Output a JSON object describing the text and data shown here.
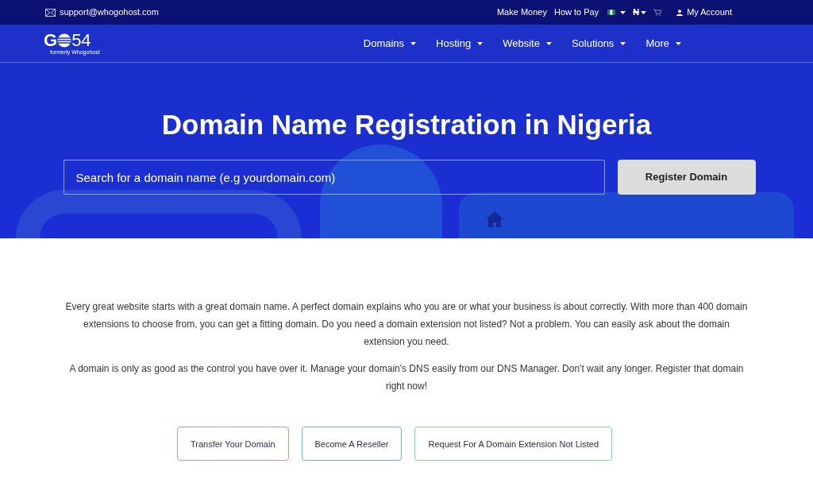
{
  "top_bar": {
    "email": "support@whogohost.com",
    "links": [
      "Make Money",
      "How to Pay"
    ],
    "currency": "₦",
    "account": "My Account"
  },
  "logo": {
    "first": "G",
    "second": "54",
    "tagline": "formerly Whogohost"
  },
  "nav": [
    "Domains",
    "Hosting",
    "Website",
    "Solutions",
    "More"
  ],
  "hero": {
    "title": "Domain Name Registration in Nigeria",
    "search": {
      "placeholder": "Search for a domain name (e.g yourdomain.com)"
    },
    "button": "Register Domain"
  },
  "paragraphs": [
    "Every great website starts with a great domain name. A perfect domain explains who you are or what your business is about correctly. With more than 400 domain extensions to choose from, you can get a fitting domain. Do you need a domain extension not listed? Not a problem. You can easily ask about the domain extension you need.",
    "A domain is only as good as the control you have over it. Manage your domain's DNS easily from our DNS Manager. Don't wait any longer. Register that domain right now!"
  ],
  "actions": [
    {
      "label": "Transfer Your Domain",
      "color": "#f28b8b"
    },
    {
      "label": "Become A Reseller",
      "color": "#6ab4ec"
    },
    {
      "label": "Request For A Domain Extension Not Listed",
      "color": "#7ddc8e"
    }
  ]
}
